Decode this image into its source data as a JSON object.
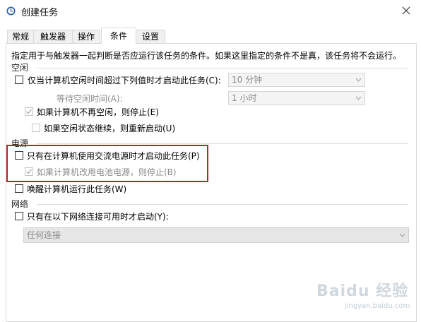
{
  "window": {
    "title": "创建任务"
  },
  "tabs": [
    {
      "label": "常规"
    },
    {
      "label": "触发器"
    },
    {
      "label": "操作"
    },
    {
      "label": "条件",
      "active": true
    },
    {
      "label": "设置"
    }
  ],
  "description": "指定用于与触发器一起判断是否应运行该任务的条件。如果这里指定的条件不是真，该任务将不会运行。",
  "idle": {
    "label": "空闲",
    "start_if_idle": "仅当计算机空闲时间超过下列值时才启动此任务(C):",
    "idle_duration": "10 分钟",
    "wait_label": "等待空闲时间(A):",
    "wait_duration": "1 小时",
    "stop_if_not_idle": "如果计算机不再空闲，则停止(E)",
    "restart_if_idle_resumes": "如果空闲状态继续，则重新启动(U)"
  },
  "power": {
    "label": "电源",
    "start_on_ac": "只有在计算机使用交流电源时才启动此任务(P)",
    "stop_on_battery": "如果计算机改用电池电源，则停止(B)",
    "wake_to_run": "唤醒计算机运行此任务(W)"
  },
  "network": {
    "label": "网络",
    "start_if_network": "只有在以下网络连接可用时才启动(Y):",
    "connection": "任何连接"
  },
  "watermark": {
    "brand": "Baidu 经验",
    "url": "jingyan.baidu.com"
  },
  "colors": {
    "highlight_border": "#b3262e",
    "disabled_text": "#8a8a8a"
  }
}
